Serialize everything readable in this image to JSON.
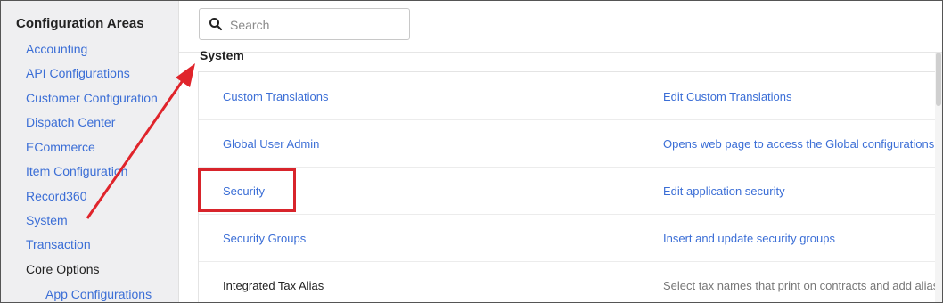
{
  "sidebar": {
    "title": "Configuration Areas",
    "items": [
      {
        "label": "Accounting"
      },
      {
        "label": "API Configurations"
      },
      {
        "label": "Customer Configuration"
      },
      {
        "label": "Dispatch Center"
      },
      {
        "label": "ECommerce"
      },
      {
        "label": "Item Configuration"
      },
      {
        "label": "Record360"
      },
      {
        "label": "System"
      },
      {
        "label": "Transaction"
      }
    ],
    "group_label": "Core Options",
    "sub_items": [
      {
        "label": "App Configurations"
      }
    ]
  },
  "search": {
    "placeholder": "Search",
    "value": ""
  },
  "section": {
    "title": "System"
  },
  "table": {
    "rows": [
      {
        "name": "Custom Translations",
        "description": "Edit Custom Translations",
        "linked": true
      },
      {
        "name": "Global User Admin",
        "description": "Opens web page to access the Global configurations t",
        "linked": true
      },
      {
        "name": "Security",
        "description": "Edit application security",
        "linked": true
      },
      {
        "name": "Security Groups",
        "description": "Insert and update security groups",
        "linked": true
      },
      {
        "name": "Integrated Tax Alias",
        "description": "Select tax names that print on contracts and add alias",
        "linked": false
      }
    ]
  },
  "colors": {
    "link": "#3b6ed6",
    "annotation": "#d8242b",
    "sidebar_bg": "#efeff1"
  },
  "icons": {
    "search": "search-icon"
  }
}
